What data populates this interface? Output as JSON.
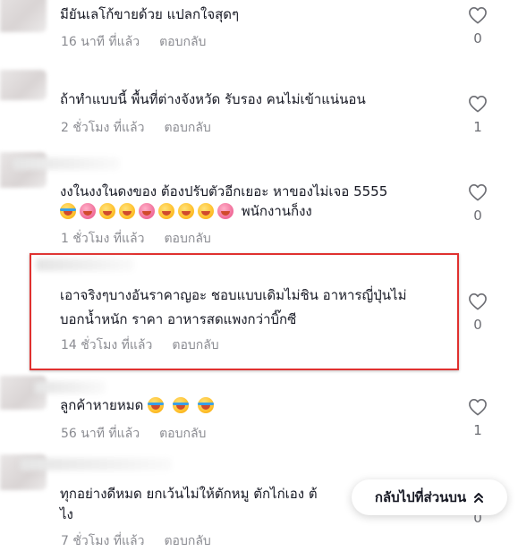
{
  "comments": [
    {
      "text": "มียันเลโก้ขายด้วย แปลกใจสุดๆ",
      "time": "16 นาที ที่แล้ว",
      "reply": "ตอบกลับ",
      "likes": "0"
    },
    {
      "text": "ถ้าทำแบบนี้ พื้นที่ต่างจังหวัด รับรอง คนไม่เข้าแน่นอน",
      "time": "2 ชั่วโมง ที่แล้ว",
      "reply": "ตอบกลับ",
      "likes": "1"
    },
    {
      "text": "งงในงงในดงของ ต้องปรับตัวอีกเยอะ หาของไม่เจอ 5555",
      "text2": "พนักงานก็งง",
      "time": "1 ชั่วโมง ที่แล้ว",
      "reply": "ตอบกลับ",
      "likes": "0"
    },
    {
      "text": "เอาจริงๆบางอันราคาญอะ ชอบแบบเดิมไม่ชิน อาหารญี่ปุ่นไม่",
      "text2": "บอกน้ำหนัก ราคา อาหารสดแพงกว่าบิ๊กซี",
      "time": "14 ชั่วโมง ที่แล้ว",
      "reply": "ตอบกลับ",
      "likes": "0"
    },
    {
      "text": "ลูกค้าหายหมด",
      "time": "56 นาที ที่แล้ว",
      "reply": "ตอบกลับ",
      "likes": "1"
    },
    {
      "text": "ทุกอย่างดีหมด ยกเว้นไม่ให้ตักหมู ตักไก่เอง ต้",
      "text2": "ไง",
      "time": "7 ชั่วโมง ที่แล้ว",
      "reply": "ตอบกลับ",
      "likes": "0"
    }
  ],
  "back_to_top": {
    "label": "กลับไปที่ส่วนบน",
    "icon": "double-chevron-up-icon"
  },
  "colors": {
    "highlight_border": "#e0312f",
    "meta_text": "#8a8b91",
    "primary_text": "#161823"
  }
}
